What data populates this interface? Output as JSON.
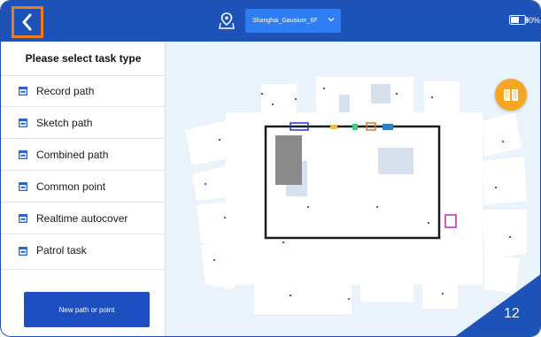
{
  "header": {
    "map_selector": "Shanghai_Gausium_6F",
    "battery_percent": "50%"
  },
  "sidebar": {
    "title": "Please select task type",
    "items": [
      {
        "label": "Record path"
      },
      {
        "label": "Sketch path"
      },
      {
        "label": "Combined path"
      },
      {
        "label": "Common point"
      },
      {
        "label": "Realtime autocover"
      },
      {
        "label": "Patrol task"
      }
    ],
    "new_button": "New path or point"
  },
  "page_number": "12",
  "colors": {
    "topbar": "#1d53b8",
    "highlight": "#f07d1a",
    "book_button": "#f6a623",
    "primary_button": "#1d4fc0"
  },
  "icons": {
    "back": "chevron-left-icon",
    "map": "map-pin-icon",
    "book": "book-icon"
  }
}
